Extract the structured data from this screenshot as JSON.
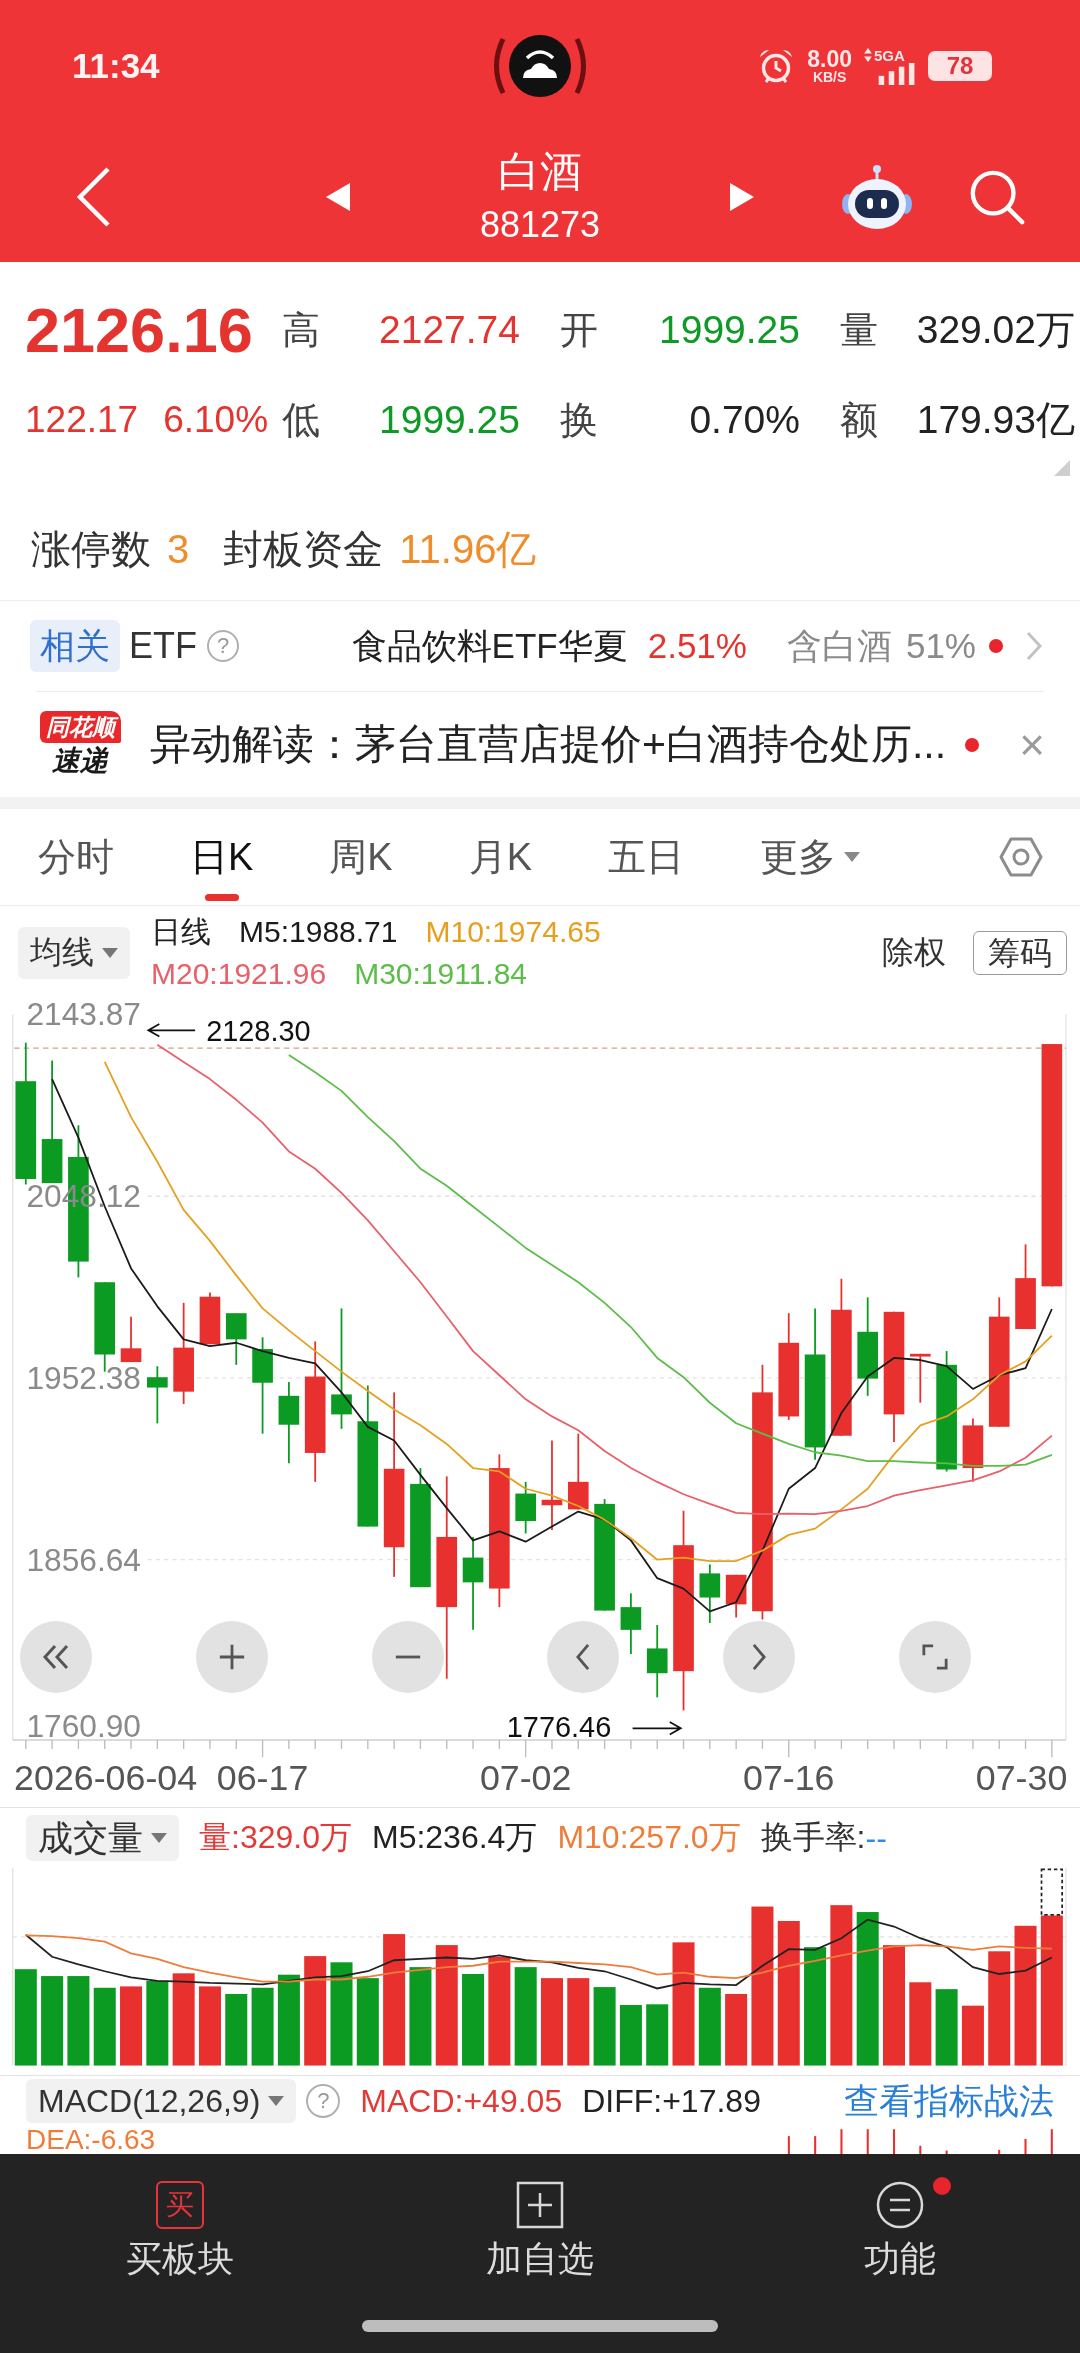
{
  "status_bar": {
    "time": "11:34",
    "speed": "8.00",
    "speed_unit": "KB/S",
    "network": "5GA",
    "battery": "78"
  },
  "header": {
    "title": "白酒",
    "code": "881273"
  },
  "quote": {
    "price": "2126.16",
    "change": "122.17",
    "change_percent": "6.10%",
    "color": "#e3342f",
    "fields": [
      {
        "label": "高",
        "value": "2127.74",
        "color": "#e3342f"
      },
      {
        "label": "开",
        "value": "1999.25",
        "color": "#0e9a26"
      },
      {
        "label": "量",
        "value": "329.02万",
        "color": "#222222"
      },
      {
        "label": "低",
        "value": "1999.25",
        "color": "#0e9a26"
      },
      {
        "label": "换",
        "value": "0.70%",
        "color": "#222222"
      },
      {
        "label": "额",
        "value": "179.93亿",
        "color": "#222222"
      }
    ]
  },
  "limit_up": {
    "count_label": "涨停数",
    "count": "3",
    "funds_label": "封板资金",
    "funds": "11.96亿"
  },
  "related_etf": {
    "tag": "相关",
    "label": "ETF",
    "help": "?",
    "name": "食品饮料ETF华夏",
    "change": "2.51%",
    "color": "#e3342f",
    "holding_label": "含白酒",
    "holding": "51%",
    "unread": true
  },
  "news": {
    "logo_top": "同花顺",
    "logo_bottom": "速递",
    "text": "异动解读：茅台直营店提价+白酒持仓处历...",
    "unread": true,
    "close": "×"
  },
  "chart_tabs": [
    {
      "label": "分时",
      "kind": "tab",
      "selected": false
    },
    {
      "label": "日K",
      "kind": "tab",
      "selected": true
    },
    {
      "label": "周K",
      "kind": "tab",
      "selected": false
    },
    {
      "label": "月K",
      "kind": "tab",
      "selected": false
    },
    {
      "label": "五日",
      "kind": "tab",
      "selected": false
    },
    {
      "label": "更多",
      "kind": "menu",
      "selected": false
    }
  ],
  "kline": {
    "indicator": "均线",
    "period": "日线",
    "adjust": "除权",
    "chips": "筹码",
    "first_date": "2026-06-04",
    "last_date": "07-30",
    "chart_data": {
      "type": "line",
      "grid": true,
      "categories": [
        null,
        null,
        null,
        null,
        null,
        null,
        null,
        null,
        null,
        "06-17",
        null,
        null,
        null,
        null,
        null,
        null,
        null,
        null,
        null,
        "07-02",
        null,
        null,
        null,
        null,
        null,
        null,
        null,
        null,
        null,
        "07-16",
        null,
        null,
        null,
        null,
        null,
        null,
        null,
        null,
        null,
        null
      ],
      "ylim": [
        1760.9,
        2143.87
      ],
      "yticks": [
        2143.87,
        2048.12,
        1952.38,
        1856.64,
        {
          "value": 1760.9,
          "label": "1760.90"
        }
      ],
      "series": [
        {
          "name": "M5:1988.71",
          "color": "#1b1b1b",
          "values": [
            null,
            2109.8,
            2079.0,
            2042.7,
            2010.1,
            1990.1,
            1972.7,
            1969.1,
            1970.9,
            1966.5,
            1962.9,
            1960.0,
            1944.8,
            1926.6,
            1919.4,
            1901.3,
            1883.8,
            1866.8,
            1871.5,
            1866.1,
            1874.1,
            1882.0,
            1877.7,
            1866.8,
            1846.9,
            1841.4,
            1829.4,
            1834.2,
            1861.4,
            1894.0,
            1904.9,
            1933.9,
            1953.1,
            1962.9,
            1961.8,
            1958.6,
            1946.6,
            1953.8,
            1957.5,
            1988.7
          ]
        },
        {
          "name": "M10:1974.65",
          "color": "#e6a020",
          "values": [
            null,
            null,
            null,
            2118.9,
            2089.8,
            2066.3,
            2040.9,
            2024.6,
            2006.4,
            1989.0,
            1977.4,
            1966.5,
            1955.7,
            1945.5,
            1935.7,
            1927.4,
            1917.6,
            1904.9,
            1903.1,
            1894.0,
            1890.4,
            1884.9,
            1877.7,
            1867.9,
            1856.6,
            1857.7,
            1855.9,
            1855.9,
            1861.4,
            1869.7,
            1873.0,
            1883.1,
            1894.0,
            1912.1,
            1927.4,
            1932.1,
            1941.1,
            1953.8,
            1961.1,
            1974.7
          ]
        },
        {
          "name": "M20:1921.96",
          "color": "#e8606a",
          "values": [
            null,
            null,
            null,
            null,
            null,
            2127.9,
            2118.9,
            2109.8,
            2098.9,
            2086.9,
            2071.7,
            2062.6,
            2049.9,
            2035.4,
            2019.1,
            2002.8,
            1984.7,
            1966.5,
            1953.8,
            1941.1,
            1932.1,
            1924.8,
            1913.9,
            1904.9,
            1897.6,
            1891.1,
            1886.0,
            1881.3,
            1880.6,
            1880.9,
            1880.6,
            1882.4,
            1884.9,
            1890.4,
            1893.3,
            1895.8,
            1898.4,
            1903.1,
            1910.3,
            1922.0
          ]
        },
        {
          "name": "M30:1911.84",
          "color": "#5cbd48",
          "values": [
            null,
            null,
            null,
            null,
            null,
            null,
            null,
            null,
            null,
            null,
            2122.5,
            2113.4,
            2103.6,
            2089.8,
            2077.1,
            2062.6,
            2053.6,
            2042.7,
            2031.8,
            2020.9,
            2011.9,
            2002.8,
            1991.9,
            1979.2,
            1962.9,
            1952.8,
            1939.3,
            1928.5,
            1923.0,
            1917.6,
            1913.2,
            1911.4,
            1908.5,
            1908.5,
            1907.8,
            1907.4,
            1906.0,
            1906.0,
            1906.7,
            1911.8
          ]
        }
      ],
      "ref_lines": [
        {
          "axis": "y",
          "value": 2126.16
        }
      ],
      "annotations": [
        "2128.30",
        "1776.46"
      ]
    }
  },
  "volume": {
    "indicator": "成交量",
    "items": [
      {
        "label": "量:329.0万",
        "color": "#e23a36"
      },
      {
        "label": "M5:236.4万",
        "color": "#222222"
      },
      {
        "label": "M10:257.0万",
        "color": "#ef7d3a"
      }
    ],
    "turnover_label": "换手率:",
    "turnover": "--"
  },
  "macd": {
    "indicator": "MACD(12,26,9)",
    "help": "?",
    "items": [
      {
        "label": "MACD:+49.05",
        "color": "#e23a36"
      },
      {
        "label": "DIFF:+17.89",
        "color": "#222222"
      }
    ],
    "link": "查看指标战法",
    "dea": {
      "label": "DEA:-6.63",
      "color": "#ef7d3a"
    }
  },
  "bottom_nav": [
    {
      "kind": "buy",
      "icon_char": "买",
      "label": "买板块",
      "badge": false
    },
    {
      "kind": "add",
      "label": "加自选",
      "badge": false
    },
    {
      "kind": "menu",
      "label": "功能",
      "badge": true
    }
  ]
}
